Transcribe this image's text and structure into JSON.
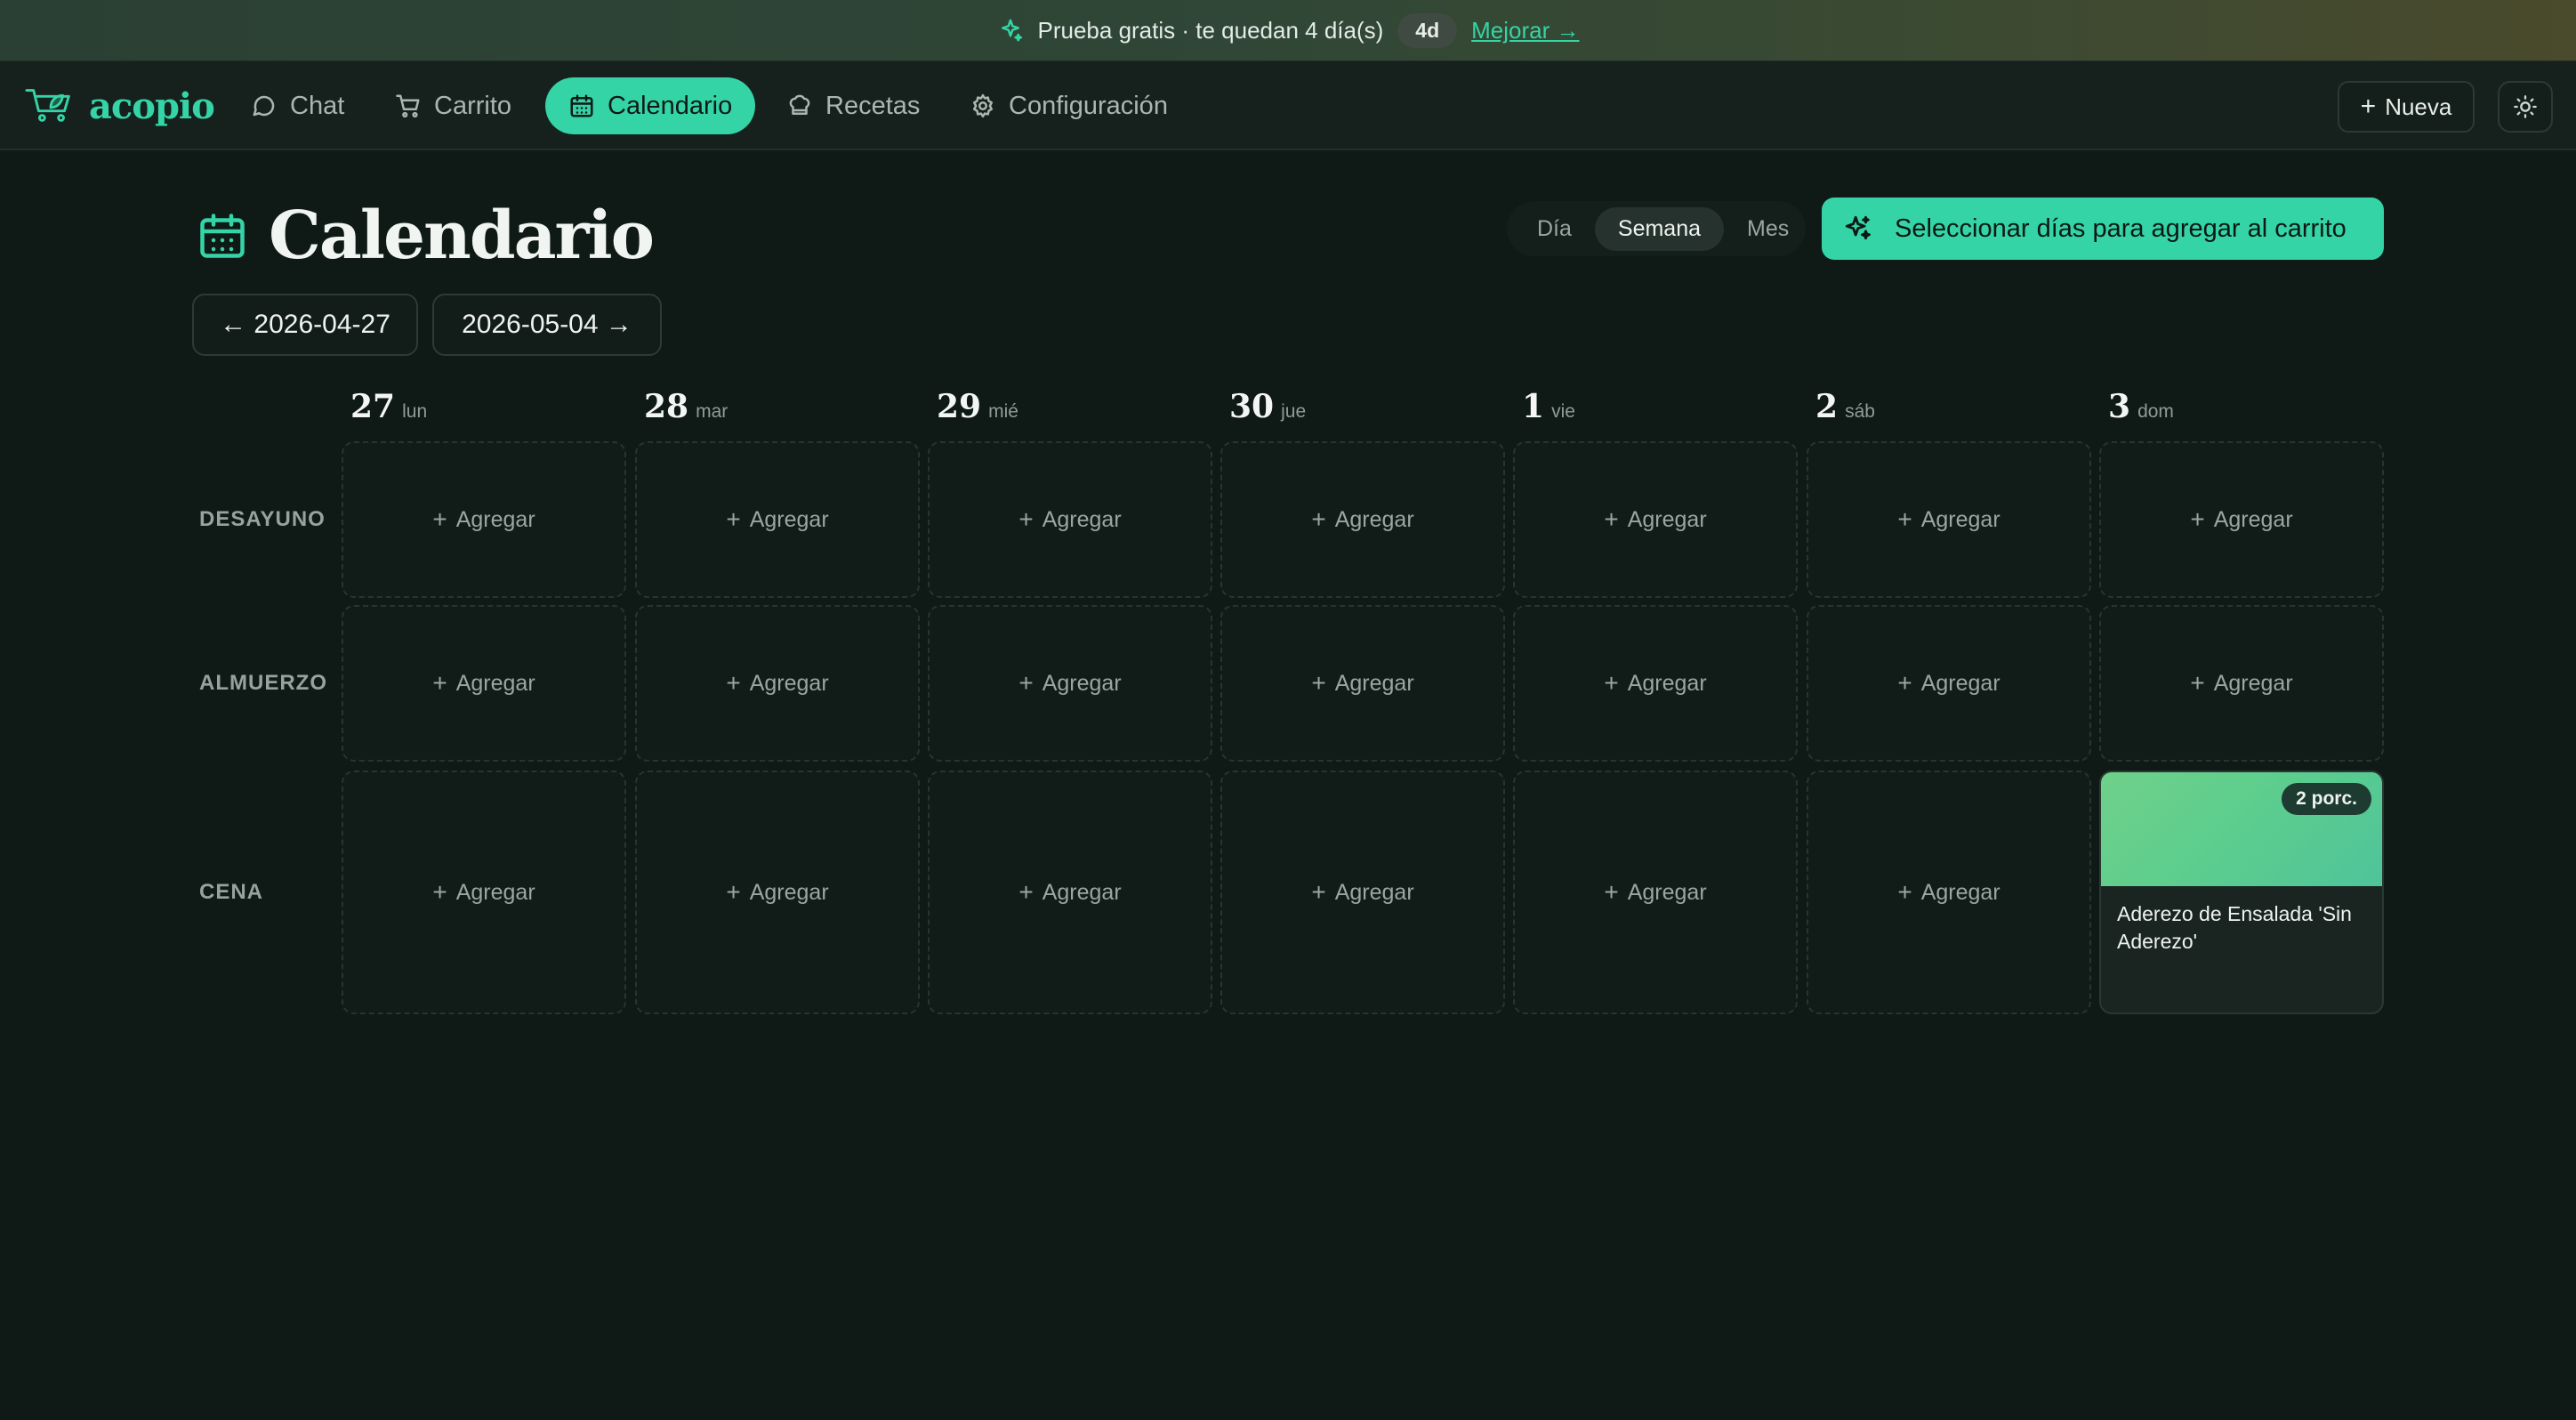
{
  "banner": {
    "text": "Prueba gratis · te quedan 4 día(s)",
    "badge": "4d",
    "upgrade": "Mejorar →"
  },
  "nav": {
    "logo": "acopio",
    "items": [
      {
        "label": "Chat",
        "icon": "chat-bubble-icon"
      },
      {
        "label": "Carrito",
        "icon": "cart-icon"
      },
      {
        "label": "Calendario",
        "icon": "calendar-icon",
        "active": true
      },
      {
        "label": "Recetas",
        "icon": "chef-hat-icon"
      },
      {
        "label": "Configuración",
        "icon": "gear-icon"
      }
    ],
    "new_button": "Nueva",
    "theme_icon": "sun-icon"
  },
  "header": {
    "title": "Calendario",
    "views": [
      "Día",
      "Semana",
      "Mes"
    ],
    "active_view": "Semana",
    "select_button": "Seleccionar días para agregar al carrito",
    "prev_week": "← 2026-04-27",
    "next_week": "2026-05-04 →"
  },
  "calendar": {
    "days": [
      {
        "num": "27",
        "name": "lun"
      },
      {
        "num": "28",
        "name": "mar"
      },
      {
        "num": "29",
        "name": "mié"
      },
      {
        "num": "30",
        "name": "jue"
      },
      {
        "num": "1",
        "name": "vie"
      },
      {
        "num": "2",
        "name": "sáb"
      },
      {
        "num": "3",
        "name": "dom"
      }
    ],
    "meals": [
      "DESAYUNO",
      "ALMUERZO",
      "CENA"
    ],
    "add_label": "Agregar",
    "planned": {
      "meal": "CENA",
      "day": "3",
      "title": "Aderezo de Ensalada 'Sin Aderezo'",
      "portions": "2 porc."
    }
  },
  "colors": {
    "accent": "#35d4a6",
    "background": "#0f1916"
  }
}
